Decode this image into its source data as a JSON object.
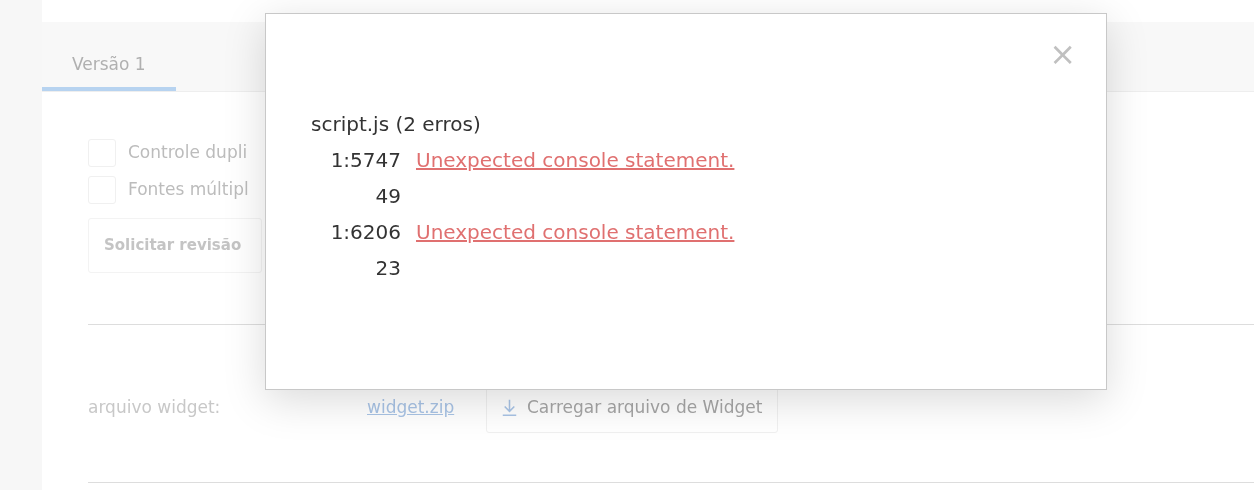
{
  "tabs": [
    {
      "label": "Versão 1",
      "selected": true
    }
  ],
  "options": [
    {
      "label": "Controle dupli",
      "checked": false
    },
    {
      "label": "Fontes múltipl",
      "checked": false
    }
  ],
  "review_button": "Solicitar revisão",
  "widget_row": {
    "label": "arquivo widget:",
    "file_link": "widget.zip",
    "upload_button": "Carregar arquivo de Widget"
  },
  "modal": {
    "file_heading": "script.js (2 erros)",
    "errors": [
      {
        "position": "1:5747",
        "column": "49",
        "message": "Unexpected console statement."
      },
      {
        "position": "1:6206",
        "column": "23",
        "message": "Unexpected console statement."
      }
    ],
    "close": "×"
  }
}
